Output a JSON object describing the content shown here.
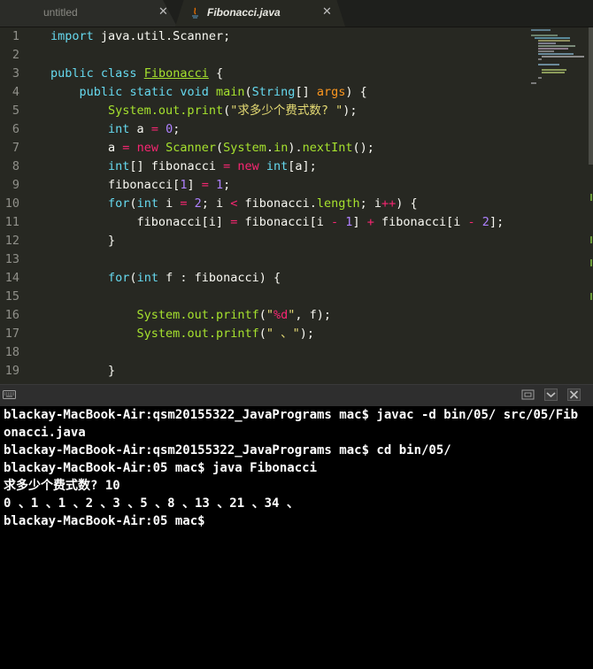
{
  "tabs": [
    {
      "label": "untitled",
      "close": "✕"
    },
    {
      "label": "Fibonacci.java",
      "close": "✕"
    }
  ],
  "editor": {
    "line_numbers": [
      "1",
      "2",
      "3",
      "4",
      "5",
      "6",
      "7",
      "8",
      "9",
      "10",
      "11",
      "12",
      "13",
      "14",
      "15",
      "16",
      "17",
      "18",
      "19"
    ]
  },
  "terminal": {
    "lines": [
      "blackay-MacBook-Air:qsm20155322_JavaPrograms mac$ javac -d bin/05/ src/05/Fib",
      "onacci.java",
      "blackay-MacBook-Air:qsm20155322_JavaPrograms mac$ cd bin/05/",
      "blackay-MacBook-Air:05 mac$ java Fibonacci",
      "求多少个费式数? 10",
      "0 、1 、1 、2 、3 、5 、8 、13 、21 、34 、",
      "blackay-MacBook-Air:05 mac$"
    ]
  },
  "colors": {
    "editor_bg": "#272822",
    "keyword": "#66d9ef",
    "operator": "#f92672",
    "string": "#e6db74",
    "number": "#ae81ff",
    "function": "#a6e22e",
    "terminal_bg": "#000000"
  },
  "icons": [
    "java-file-icon",
    "tab-close-icon",
    "keyboard-icon",
    "maximize-icon",
    "chevron-down-icon",
    "close-panel-icon"
  ]
}
